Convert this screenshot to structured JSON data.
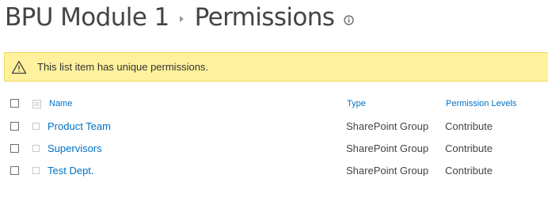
{
  "header": {
    "site_title": "BPU Module 1",
    "page_title": "Permissions",
    "info_icon": "info-icon",
    "breadcrumb_icon": "chevron-right-icon"
  },
  "banner": {
    "icon": "warning-icon",
    "message": "This list item has unique permissions.",
    "background": "#fff19d"
  },
  "table": {
    "columns": {
      "name": "Name",
      "type": "Type",
      "permission_levels": "Permission Levels"
    },
    "rows": [
      {
        "name": "Product Team",
        "type": "SharePoint Group",
        "permission_levels": "Contribute"
      },
      {
        "name": "Supervisors",
        "type": "SharePoint Group",
        "permission_levels": "Contribute"
      },
      {
        "name": "Test Dept.",
        "type": "SharePoint Group",
        "permission_levels": "Contribute"
      }
    ]
  },
  "colors": {
    "link": "#0072c6",
    "text": "#444444"
  }
}
